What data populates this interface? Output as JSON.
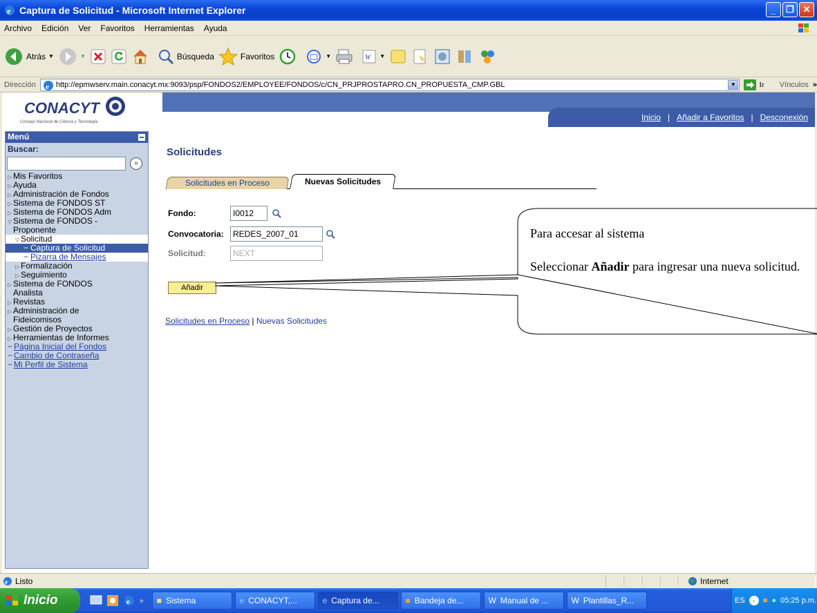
{
  "window": {
    "title": "Captura de Solicitud - Microsoft Internet Explorer"
  },
  "menubar": [
    "Archivo",
    "Edición",
    "Ver",
    "Favoritos",
    "Herramientas",
    "Ayuda"
  ],
  "toolbar": {
    "back_label": "Atrás",
    "search_label": "Búsqueda",
    "favorites_label": "Favoritos"
  },
  "address": {
    "label": "Dirección",
    "url": "http://epmwserv.main.conacyt.mx:9093/psp/FONDOS2/EMPLOYEE/FONDOS/c/CN_PRJPROSTAPRO.CN_PROPUESTA_CMP.GBL",
    "go_label": "Ir",
    "links_label": "Vínculos"
  },
  "header": {
    "logo_text": "CONACYT",
    "logo_sub": "Consejo Nacional de Ciencia y Tecnología",
    "nav": [
      "Inicio",
      "Añadir a Favoritos",
      "Desconexión"
    ]
  },
  "menu": {
    "title": "Menú",
    "search_label": "Buscar:",
    "items": [
      {
        "label": "Mis Favoritos",
        "kind": "closed"
      },
      {
        "label": "Ayuda",
        "kind": "closed"
      },
      {
        "label": "Administración de Fondos",
        "kind": "closed"
      },
      {
        "label": "Sistema de FONDOS ST",
        "kind": "closed"
      },
      {
        "label": "Sistema de FONDOS Adm",
        "kind": "closed"
      },
      {
        "label": "Sistema de FONDOS -",
        "kind": "open"
      },
      {
        "label": "Proponente",
        "kind": "cont"
      },
      {
        "label": "Solicitud",
        "kind": "open-sub"
      },
      {
        "label": "Captura de Solicitud",
        "kind": "selected"
      },
      {
        "label": "Pizarra de Mensajes",
        "kind": "sublink"
      },
      {
        "label": "Formalización",
        "kind": "closed-sub"
      },
      {
        "label": "Seguimiento",
        "kind": "closed-sub"
      },
      {
        "label": "Sistema de FONDOS",
        "kind": "closed"
      },
      {
        "label": "Analista",
        "kind": "cont"
      },
      {
        "label": "Revistas",
        "kind": "closed"
      },
      {
        "label": "Administración de",
        "kind": "closed"
      },
      {
        "label": "Fideicomisos",
        "kind": "cont"
      },
      {
        "label": "Gestión de Proyectos",
        "kind": "closed"
      },
      {
        "label": "Herramientas de Informes",
        "kind": "closed"
      },
      {
        "label": "Página Inicial del Fondos",
        "kind": "link"
      },
      {
        "label": "Cambio de Contraseña",
        "kind": "link"
      },
      {
        "label": "Mi Perfil de Sistema",
        "kind": "link"
      }
    ]
  },
  "page": {
    "title": "Solicitudes",
    "tabs": [
      "Solicitudes en Proceso",
      "Nuevas Solicitudes"
    ],
    "fields": {
      "fondo_label": "Fondo:",
      "fondo_value": "I0012",
      "convocatoria_label": "Convocatoria:",
      "convocatoria_value": "REDES_2007_01",
      "solicitud_label": "Solicitud:",
      "solicitud_value": "NEXT"
    },
    "add_button": "Añadir",
    "bottom_links": [
      "Solicitudes en Proceso",
      "Nuevas Solicitudes"
    ]
  },
  "callout": {
    "line1": "Para accesar al sistema",
    "line2_pre": "Seleccionar ",
    "line2_bold": "Añadir",
    "line2_post": " para ingresar una nueva solicitud."
  },
  "status": {
    "text": "Listo",
    "zone": "Internet"
  },
  "taskbar": {
    "start": "Inicio",
    "tasks": [
      "Sistema",
      "CONACYT,...",
      "Captura de...",
      "Bandeja de...",
      "Manual de ...",
      "Plantillas_R..."
    ],
    "lang": "ES",
    "clock": "05:25 p.m."
  }
}
